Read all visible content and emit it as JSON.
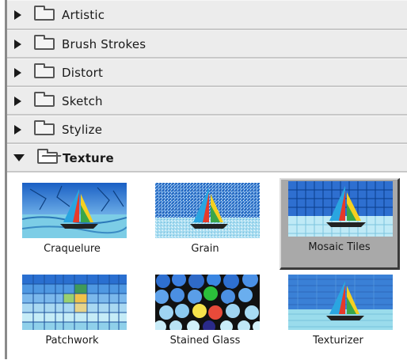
{
  "categories": [
    {
      "label": "Artistic",
      "expanded": false
    },
    {
      "label": "Brush Strokes",
      "expanded": false
    },
    {
      "label": "Distort",
      "expanded": false
    },
    {
      "label": "Sketch",
      "expanded": false
    },
    {
      "label": "Stylize",
      "expanded": false
    },
    {
      "label": "Texture",
      "expanded": true
    }
  ],
  "filters": [
    {
      "label": "Craquelure",
      "selected": false
    },
    {
      "label": "Grain",
      "selected": false
    },
    {
      "label": "Mosaic Tiles",
      "selected": true
    },
    {
      "label": "Patchwork",
      "selected": false
    },
    {
      "label": "Stained Glass",
      "selected": false
    },
    {
      "label": "Texturizer",
      "selected": false
    }
  ],
  "colors": {
    "row_background": "#ececec",
    "selected_tile": "#a9a9a9",
    "sky": "#1f6fd6",
    "water": "#9fe0f0"
  }
}
